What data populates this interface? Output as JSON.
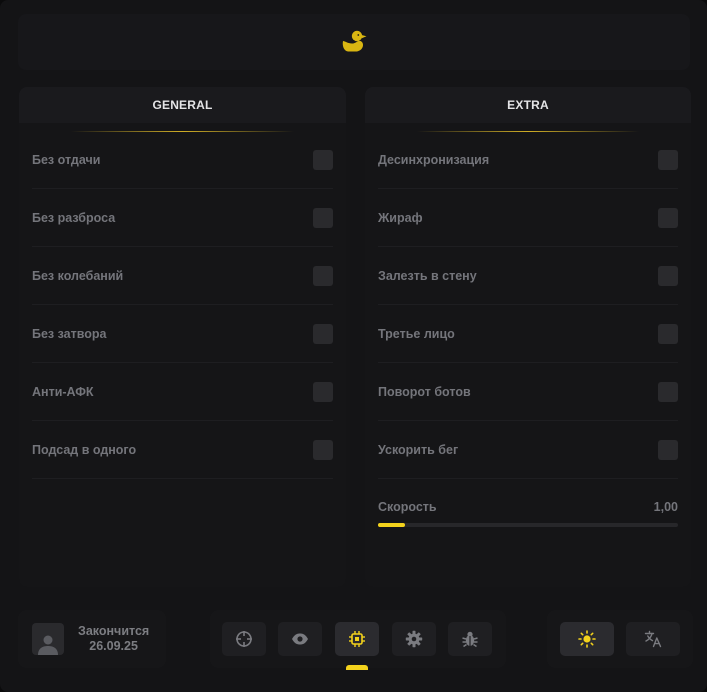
{
  "header": {
    "logo_icon": "duck-icon"
  },
  "general": {
    "title": "GENERAL",
    "items": [
      {
        "label": "Без отдачи",
        "checked": false
      },
      {
        "label": "Без разброса",
        "checked": false
      },
      {
        "label": "Без колебаний",
        "checked": false
      },
      {
        "label": "Без затвора",
        "checked": false
      },
      {
        "label": "Анти-АФК",
        "checked": false
      },
      {
        "label": "Подсад в одного",
        "checked": false
      }
    ]
  },
  "extra": {
    "title": "EXTRA",
    "items": [
      {
        "label": "Десинхронизация",
        "checked": false
      },
      {
        "label": "Жираф",
        "checked": false
      },
      {
        "label": "Залезть в стену",
        "checked": false
      },
      {
        "label": "Третье лицо",
        "checked": false
      },
      {
        "label": "Поворот ботов",
        "checked": false
      },
      {
        "label": "Ускорить бег",
        "checked": false
      }
    ],
    "speed": {
      "label": "Скорость",
      "value": "1,00",
      "fraction": 0.09
    }
  },
  "user": {
    "expires_label": "Закончится",
    "expires_date": "26.09.25"
  },
  "nav": {
    "icons": [
      "crosshair-icon",
      "eye-icon",
      "chip-icon",
      "gear-icon",
      "bug-icon"
    ],
    "active_index": 2
  },
  "controls": {
    "theme_icon": "sun-icon",
    "language_icon": "translate-icon"
  },
  "colors": {
    "accent": "#f3d21c",
    "background": "#141416",
    "panel": "#151517"
  }
}
